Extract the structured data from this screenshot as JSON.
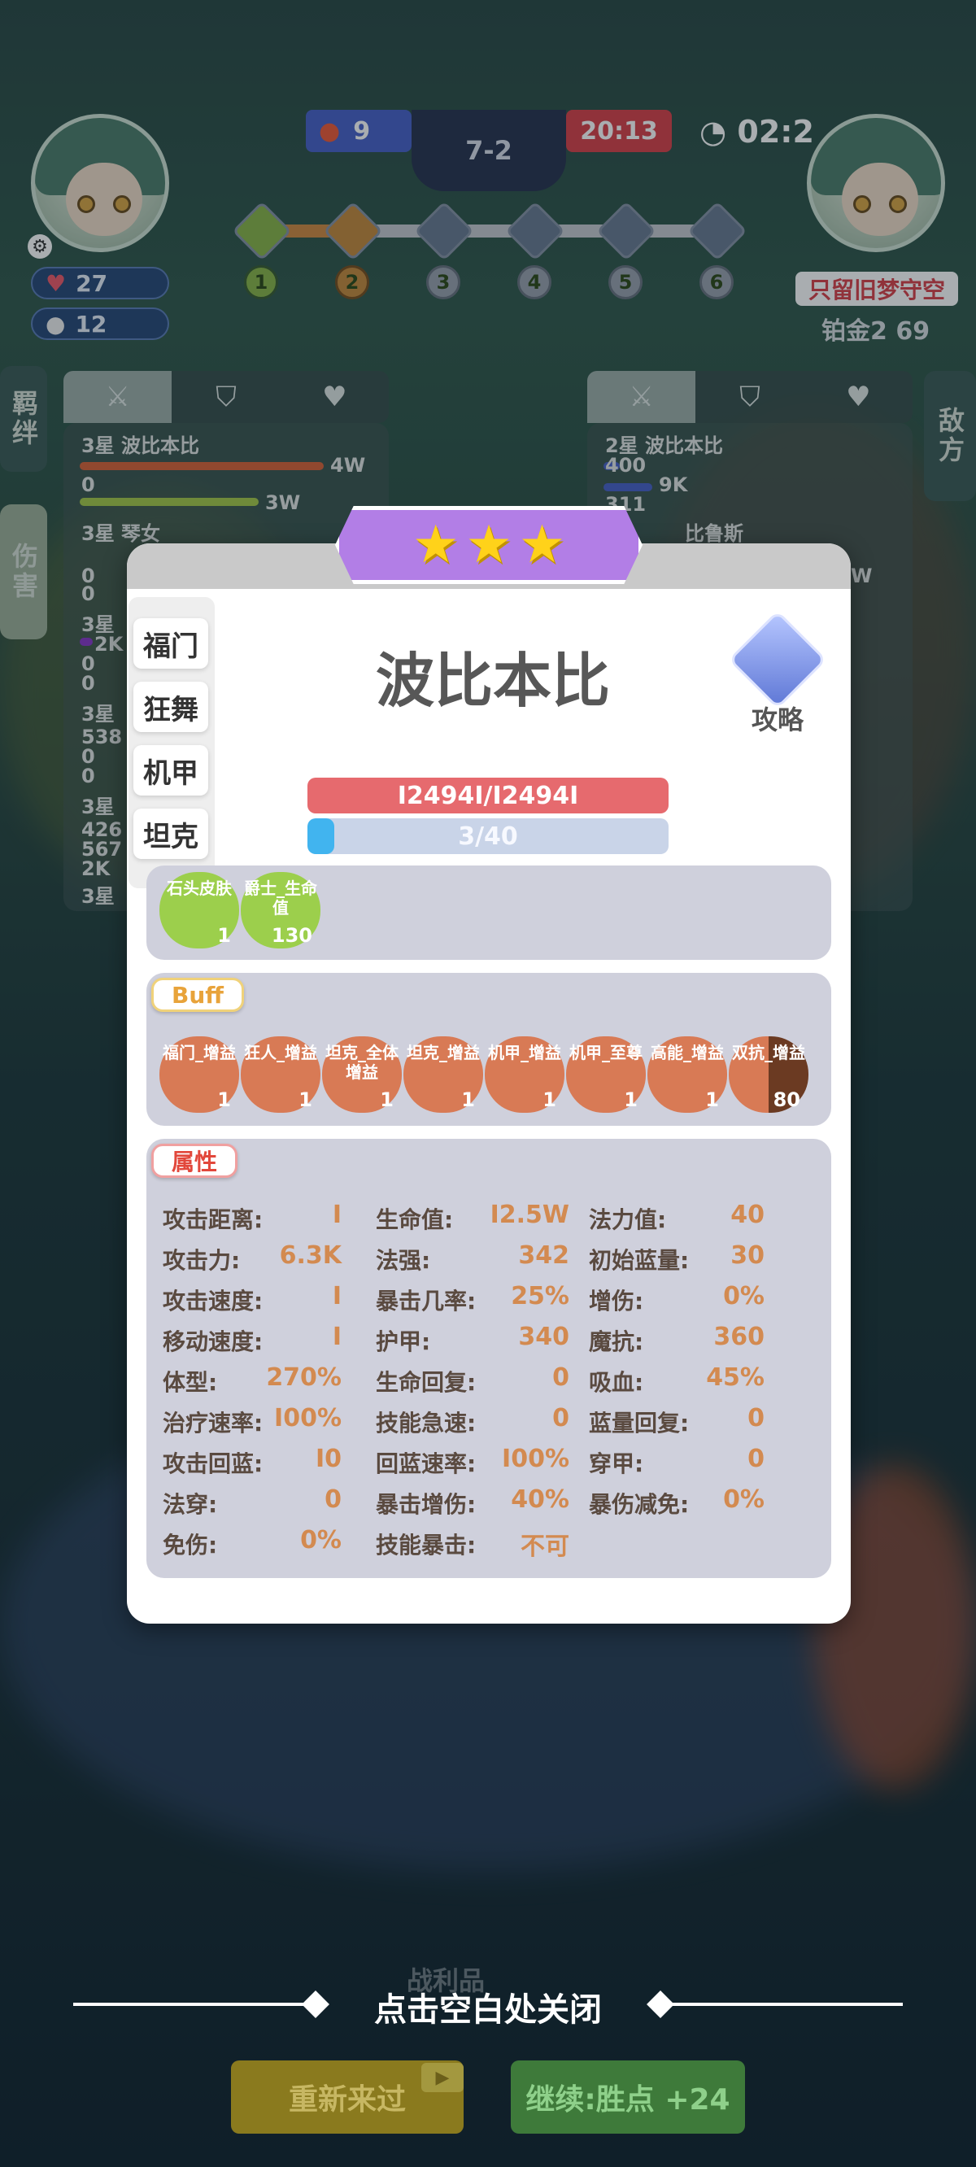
{
  "top": {
    "left_hp": "9",
    "stage": "7-2",
    "right_hp": "20:13",
    "timer": "02:2",
    "rounds": [
      "1",
      "2",
      "3",
      "4",
      "5",
      "6"
    ]
  },
  "left_player": {
    "health": "27",
    "coins": "12"
  },
  "right_player": {
    "name": "只留旧梦守空",
    "rank": "铂金2 69"
  },
  "side_tabs": {
    "bond": "羁绊",
    "damage": "伤害",
    "enemy": "敌方"
  },
  "left_panel": {
    "rows": [
      {
        "name": "3星 波比本比",
        "v1": "4W",
        "v2": "0",
        "v3": "3W"
      },
      {
        "name": "3星 琴女",
        "v1": "0",
        "v2": "0"
      },
      {
        "name": "3星",
        "v1": "2K",
        "v2": "0",
        "v3": "0"
      },
      {
        "name": "3星",
        "v1": "538",
        "v2": "0",
        "v3": "0"
      },
      {
        "name": "3星",
        "v1": "426",
        "v2": "567",
        "v3": "2K"
      },
      {
        "name": "3星"
      }
    ]
  },
  "right_panel": {
    "rows": [
      {
        "name": "2星 波比本比",
        "v1": "400",
        "v2": "9K",
        "v3": "311"
      },
      {
        "name": "比鲁斯",
        "v1": "W"
      }
    ]
  },
  "modal": {
    "stars": "★",
    "name": "波比本比",
    "guide": "攻略",
    "traits": [
      "福门",
      "狂舞",
      "机甲",
      "坦克"
    ],
    "hp": "I2494I/I2494I",
    "mana": "3/40",
    "mana_fraction": 0.075,
    "items": [
      {
        "label": "石头皮肤",
        "count": "1"
      },
      {
        "label": "爵士_生命值",
        "count": "130"
      }
    ],
    "buff_title": "Buff",
    "buffs": [
      {
        "label": "福门_增益",
        "count": "1"
      },
      {
        "label": "狂人_增益",
        "count": "1"
      },
      {
        "label": "坦克_全体增益",
        "count": "1"
      },
      {
        "label": "坦克_增益",
        "count": "1"
      },
      {
        "label": "机甲_增益",
        "count": "1"
      },
      {
        "label": "机甲_至尊",
        "count": "1"
      },
      {
        "label": "高能_增益",
        "count": "1"
      },
      {
        "label": "双抗_增益",
        "count": "80"
      }
    ],
    "attr_title": "属性",
    "attrs": [
      [
        {
          "k": "攻击距离:",
          "v": "I"
        },
        {
          "k": "生命值:",
          "v": "I2.5W"
        },
        {
          "k": "法力值:",
          "v": "40"
        }
      ],
      [
        {
          "k": "攻击力:",
          "v": "6.3K"
        },
        {
          "k": "法强:",
          "v": "342"
        },
        {
          "k": "初始蓝量:",
          "v": "30"
        }
      ],
      [
        {
          "k": "攻击速度:",
          "v": "I"
        },
        {
          "k": "暴击几率:",
          "v": "25%"
        },
        {
          "k": "增伤:",
          "v": "0%"
        }
      ],
      [
        {
          "k": "移动速度:",
          "v": "I"
        },
        {
          "k": "护甲:",
          "v": "340"
        },
        {
          "k": "魔抗:",
          "v": "360"
        }
      ],
      [
        {
          "k": "体型:",
          "v": "270%"
        },
        {
          "k": "生命回复:",
          "v": "0"
        },
        {
          "k": "吸血:",
          "v": "45%"
        }
      ],
      [
        {
          "k": "治疗速率:",
          "v": "I00%"
        },
        {
          "k": "技能急速:",
          "v": "0"
        },
        {
          "k": "蓝量回复:",
          "v": "0"
        }
      ],
      [
        {
          "k": "攻击回蓝:",
          "v": "I0"
        },
        {
          "k": "回蓝速率:",
          "v": "I00%"
        },
        {
          "k": "穿甲:",
          "v": "0"
        }
      ],
      [
        {
          "k": "法穿:",
          "v": "0"
        },
        {
          "k": "暴击增伤:",
          "v": "40%"
        },
        {
          "k": "暴伤减免:",
          "v": "0%"
        }
      ],
      [
        {
          "k": "免伤:",
          "v": "0%"
        },
        {
          "k": "技能暴击:",
          "v": "不可"
        }
      ]
    ]
  },
  "bottom": {
    "behind_text": "战利品",
    "close_hint": "点击空白处关闭",
    "retry": "重新来过",
    "continue": "继续:胜点 +24"
  },
  "colors": {
    "hp": "#e66a6e",
    "mana": "#41b4ef",
    "stars": "#b27ee6",
    "value": "#d38a50"
  }
}
